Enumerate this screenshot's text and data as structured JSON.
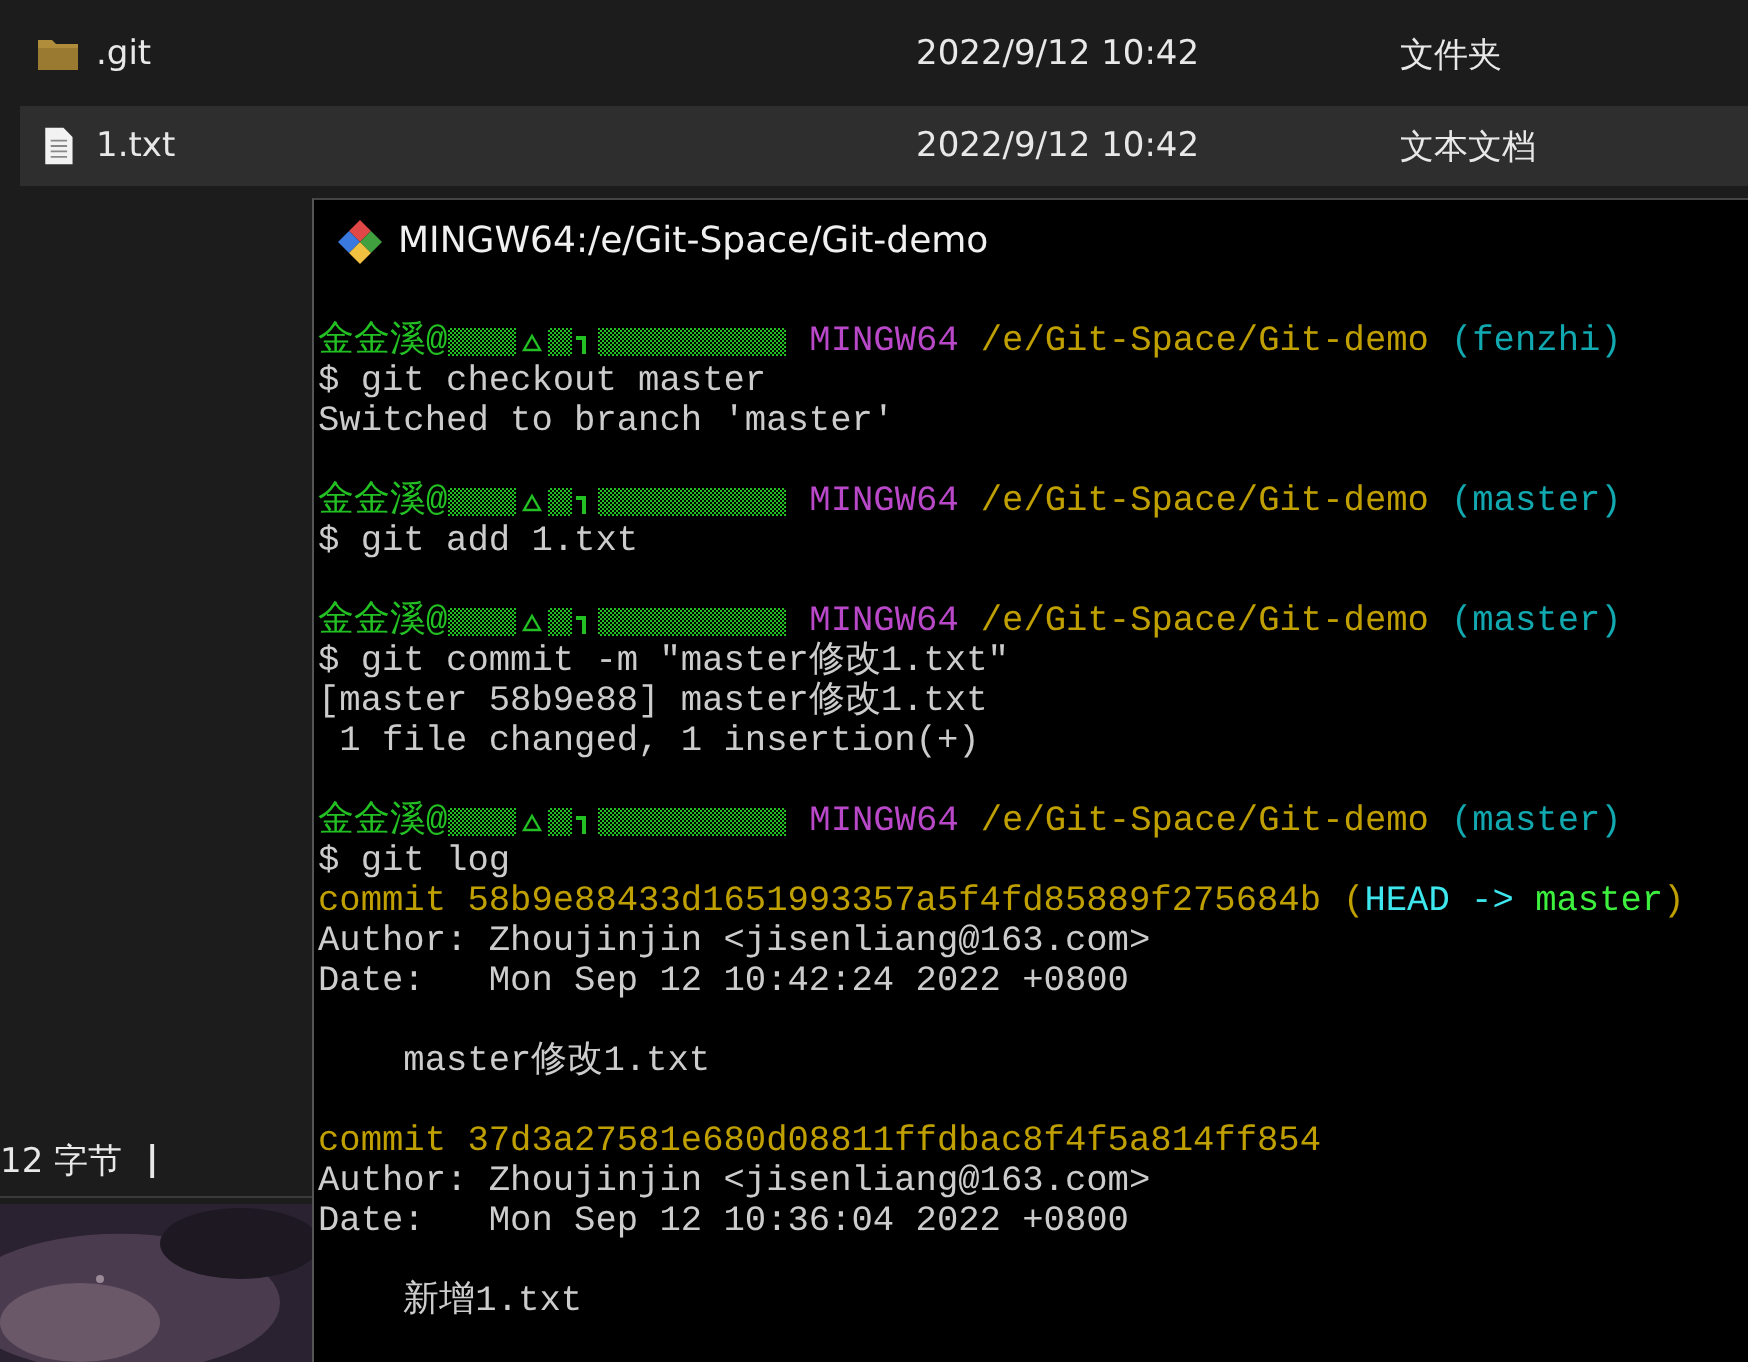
{
  "explorer": {
    "files": [
      {
        "kind": "folder",
        "name": ".git",
        "modified": "2022/9/12 10:42",
        "type": "文件夹",
        "selected": false
      },
      {
        "kind": "text",
        "name": "1.txt",
        "modified": "2022/9/12 10:42",
        "type": "文本文档",
        "selected": true
      }
    ],
    "status": {
      "size": "12 字节",
      "separator": "|"
    }
  },
  "terminal": {
    "title": "MINGW64:/e/Git-Space/Git-demo",
    "lines": [
      {
        "kind": "blank"
      },
      {
        "kind": "prompt",
        "user": "金金溪@",
        "system": "MINGW64",
        "path": "/e/Git-Space/Git-demo",
        "branch": "(fenzhi)"
      },
      {
        "kind": "command",
        "text": "$ git checkout master"
      },
      {
        "kind": "output",
        "text": "Switched to branch 'master'"
      },
      {
        "kind": "blank"
      },
      {
        "kind": "prompt",
        "user": "金金溪@",
        "system": "MINGW64",
        "path": "/e/Git-Space/Git-demo",
        "branch": "(master)"
      },
      {
        "kind": "command",
        "text": "$ git add 1.txt"
      },
      {
        "kind": "blank"
      },
      {
        "kind": "prompt",
        "user": "金金溪@",
        "system": "MINGW64",
        "path": "/e/Git-Space/Git-demo",
        "branch": "(master)"
      },
      {
        "kind": "command",
        "text": "$ git commit -m \"master修改1.txt\""
      },
      {
        "kind": "output",
        "text": "[master 58b9e88] master修改1.txt"
      },
      {
        "kind": "output",
        "text": " 1 file changed, 1 insertion(+)"
      },
      {
        "kind": "blank"
      },
      {
        "kind": "prompt",
        "user": "金金溪@",
        "system": "MINGW64",
        "path": "/e/Git-Space/Git-demo",
        "branch": "(master)"
      },
      {
        "kind": "command",
        "text": "$ git log"
      },
      {
        "kind": "commit",
        "text": "commit 58b9e88433d1651993357a5f4fd85889f275684b",
        "refs": [
          {
            "text": "(",
            "color": "#c0a000"
          },
          {
            "text": "HEAD -> ",
            "color": "#3ee6ee"
          },
          {
            "text": "master",
            "color": "#3ef03e"
          },
          {
            "text": ")",
            "color": "#c0a000"
          }
        ]
      },
      {
        "kind": "output",
        "text": "Author: Zhoujinjin <jisenliang@163.com>"
      },
      {
        "kind": "output",
        "text": "Date:   Mon Sep 12 10:42:24 2022 +0800"
      },
      {
        "kind": "blank"
      },
      {
        "kind": "output",
        "text": "    master修改1.txt"
      },
      {
        "kind": "blank"
      },
      {
        "kind": "commit",
        "text": "commit 37d3a27581e680d08811ffdbac8f4f5a814ff854"
      },
      {
        "kind": "output",
        "text": "Author: Zhoujinjin <jisenliang@163.com>"
      },
      {
        "kind": "output",
        "text": "Date:   Mon Sep 12 10:36:04 2022 +0800"
      },
      {
        "kind": "blank"
      },
      {
        "kind": "output",
        "text": "    新增1.txt"
      }
    ]
  }
}
